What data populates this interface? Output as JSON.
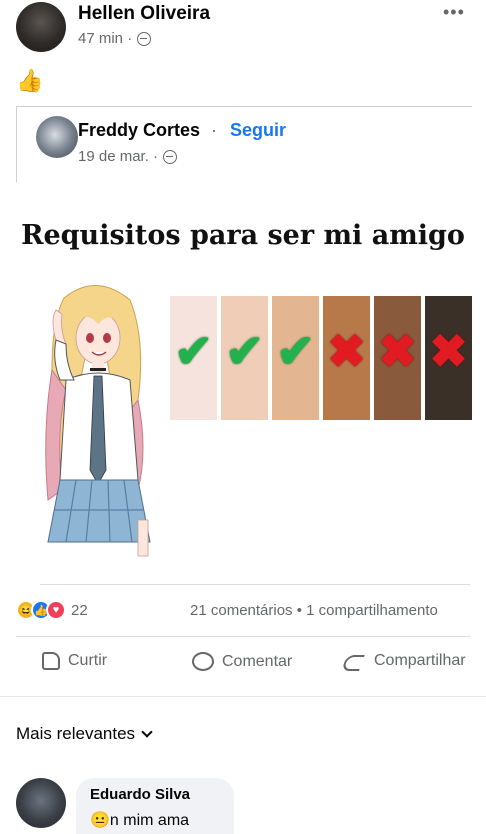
{
  "post": {
    "author": "Hellen Oliveira",
    "time": "47 min ·",
    "more_icon": "•••",
    "reaction_emoji": "👍"
  },
  "shared": {
    "author": "Freddy Cortes",
    "dot": "·",
    "follow": "Seguir",
    "date": "19 de mar. ·"
  },
  "meme": {
    "title": "Requisitos para ser mi amigo",
    "swatches": [
      {
        "color": "#f7e3dd",
        "mark": "✔",
        "status": "ok"
      },
      {
        "color": "#efcdb7",
        "mark": "✔",
        "status": "ok"
      },
      {
        "color": "#e3b691",
        "mark": "✔",
        "status": "ok"
      },
      {
        "color": "#b8794a",
        "mark": "✖",
        "status": "no"
      },
      {
        "color": "#8a5a3c",
        "mark": "✖",
        "status": "no"
      },
      {
        "color": "#3a3028",
        "mark": "✖",
        "status": "no"
      }
    ]
  },
  "stats": {
    "reactions_count": "22",
    "comments_shares": "21 comentários • 1 compartilhamento"
  },
  "actions": {
    "like": "Curtir",
    "comment": "Comentar",
    "share": "Compartilhar"
  },
  "sort": {
    "label": "Mais relevantes"
  },
  "comment": {
    "name": "Eduardo Silva",
    "text": "😐n mim ama"
  }
}
